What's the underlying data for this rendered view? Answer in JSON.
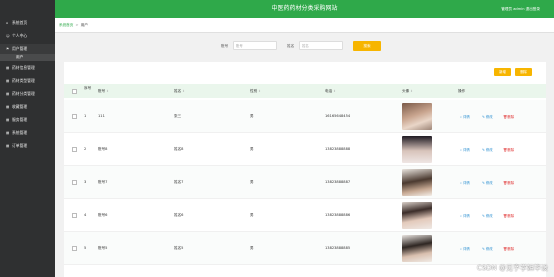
{
  "header": {
    "title": "中医药药材分类采购网站",
    "user_text": "管理员 admin  退出登录"
  },
  "sidebar": {
    "items": [
      {
        "label": "系统首页",
        "icon": "home-icon"
      },
      {
        "label": "个人中心",
        "icon": "user-icon"
      },
      {
        "label": "用户管理",
        "icon": "flag-icon"
      },
      {
        "label": "药材信息管理",
        "icon": "grid-icon"
      },
      {
        "label": "药材类型管理",
        "icon": "grid-icon"
      },
      {
        "label": "药材分类管理",
        "icon": "grid-icon"
      },
      {
        "label": "收藏管理",
        "icon": "grid-icon"
      },
      {
        "label": "服务管理",
        "icon": "grid-icon"
      },
      {
        "label": "系统管理",
        "icon": "grid-icon"
      },
      {
        "label": "订单管理",
        "icon": "grid-icon"
      }
    ],
    "sub_item": "用户"
  },
  "breadcrumb": {
    "home": "系统首页",
    "sep": ">",
    "current": "用户"
  },
  "search": {
    "account_label": "账号",
    "account_placeholder": "账号",
    "name_label": "姓名",
    "name_placeholder": "姓名",
    "button": "搜索"
  },
  "toolbar": {
    "add": "新增",
    "delete": "删除"
  },
  "table": {
    "headers": [
      "序号",
      "账号",
      "姓名",
      "性别",
      "电话",
      "头像",
      "操作"
    ],
    "rows": [
      {
        "index": "1",
        "account": "111",
        "name": "张三",
        "gender": "男",
        "phone": "16165648454"
      },
      {
        "index": "2",
        "account": "账号8",
        "name": "姓名8",
        "gender": "男",
        "phone": "13823888888"
      },
      {
        "index": "3",
        "account": "账号7",
        "name": "姓名7",
        "gender": "男",
        "phone": "13823888887"
      },
      {
        "index": "4",
        "account": "账号6",
        "name": "姓名6",
        "gender": "男",
        "phone": "13823888886"
      },
      {
        "index": "5",
        "account": "账号5",
        "name": "姓名5",
        "gender": "男",
        "phone": "13823888885"
      }
    ],
    "actions": {
      "detail": "详情",
      "edit": "修改",
      "delete": "删除"
    }
  },
  "watermark": "CSDN @见字学姐毕设"
}
